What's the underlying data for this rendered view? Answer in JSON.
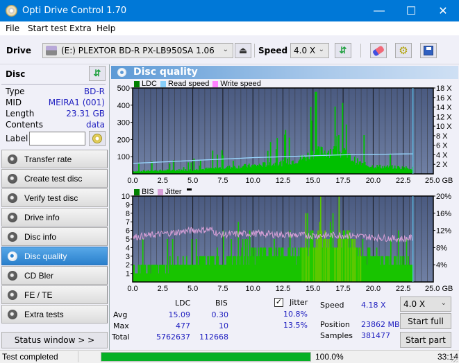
{
  "window": {
    "title": "Opti Drive Control 1.70",
    "controls": {
      "minimize": "—",
      "maximize": "☐",
      "close": "✕"
    }
  },
  "menu": {
    "items": [
      "File",
      "Start test",
      "Extra",
      "Help"
    ]
  },
  "toolbar": {
    "drive_label": "Drive",
    "drive_value": "(E:)  PLEXTOR BD-R  PX-LB950SA 1.06",
    "speed_label": "Speed",
    "speed_value": "4.0 X",
    "icons": [
      "drive-icon",
      "eject-icon",
      "refresh-icon",
      "eraser-icon",
      "settings-icon",
      "save-icon"
    ]
  },
  "disc": {
    "header": "Disc",
    "fields": [
      {
        "label": "Type",
        "value": "BD-R"
      },
      {
        "label": "MID",
        "value": "MEIRA1 (001)"
      },
      {
        "label": "Length",
        "value": "23.31 GB"
      },
      {
        "label": "Contents",
        "value": "data"
      }
    ],
    "label_field": {
      "label": "Label",
      "value": ""
    }
  },
  "nav": {
    "items": [
      {
        "label": "Transfer rate",
        "active": false
      },
      {
        "label": "Create test disc",
        "active": false
      },
      {
        "label": "Verify test disc",
        "active": false
      },
      {
        "label": "Drive info",
        "active": false
      },
      {
        "label": "Disc info",
        "active": false
      },
      {
        "label": "Disc quality",
        "active": true
      },
      {
        "label": "CD Bler",
        "active": false
      },
      {
        "label": "FE / TE",
        "active": false
      },
      {
        "label": "Extra tests",
        "active": false
      }
    ],
    "status_window": "Status window > >"
  },
  "panel": {
    "title": "Disc quality"
  },
  "chart_data": [
    {
      "type": "bar",
      "title": "LDC chart",
      "legend": [
        "LDC",
        "Read speed",
        "Write speed"
      ],
      "legend_colors": [
        "#008000",
        "#87cefa",
        "#ff80ff"
      ],
      "x_ticks": [
        "0.0",
        "2.5",
        "5.0",
        "7.5",
        "10.0",
        "12.5",
        "15.0",
        "17.5",
        "20.0",
        "22.5",
        "25.0 GB"
      ],
      "xlim": [
        0,
        25
      ],
      "y_ticks_left": [
        "500",
        "400",
        "300",
        "200",
        "100"
      ],
      "ylim_left": [
        0,
        500
      ],
      "y_ticks_right": [
        "18 X",
        "16 X",
        "14 X",
        "12 X",
        "10 X",
        "8 X",
        "6 X",
        "4 X",
        "2 X"
      ],
      "ylim_right": [
        0,
        18
      ],
      "end_marker_gb": 23.31,
      "ldc_base_profile": [
        [
          0,
          20
        ],
        [
          2.5,
          25
        ],
        [
          5,
          30
        ],
        [
          7.5,
          45
        ],
        [
          10,
          60
        ],
        [
          12.5,
          80
        ],
        [
          14,
          110
        ],
        [
          15,
          150
        ],
        [
          16.5,
          170
        ],
        [
          17.5,
          150
        ],
        [
          18,
          120
        ],
        [
          19,
          70
        ],
        [
          20,
          55
        ],
        [
          22.5,
          45
        ],
        [
          23.31,
          40
        ]
      ],
      "ldc_spike_max": 477,
      "read_speed_profile": [
        [
          0,
          2.2
        ],
        [
          2.5,
          2.5
        ],
        [
          5,
          2.8
        ],
        [
          7.5,
          3.1
        ],
        [
          10,
          3.4
        ],
        [
          12.5,
          3.6
        ],
        [
          15,
          3.8
        ],
        [
          17.5,
          4.0
        ],
        [
          20,
          4.1
        ],
        [
          23.31,
          4.2
        ]
      ]
    },
    {
      "type": "bar",
      "title": "BIS chart",
      "legend": [
        "BIS",
        "Jitter"
      ],
      "legend_colors": [
        "#008000",
        "#d8a0d8"
      ],
      "x_ticks": [
        "0.0",
        "2.5",
        "5.0",
        "7.5",
        "10.0",
        "12.5",
        "15.0",
        "17.5",
        "20.0",
        "22.5",
        "25.0 GB"
      ],
      "xlim": [
        0,
        25
      ],
      "y_ticks_left": [
        "10",
        "9",
        "8",
        "7",
        "6",
        "5",
        "4",
        "3",
        "2",
        "1"
      ],
      "ylim_left": [
        0,
        10
      ],
      "y_ticks_right": [
        "20%",
        "16%",
        "12%",
        "8%",
        "4%"
      ],
      "ylim_right": [
        0,
        20
      ],
      "end_marker_gb": 23.31,
      "bis_base_profile": [
        [
          0,
          2
        ],
        [
          7,
          3
        ],
        [
          11,
          4
        ],
        [
          14,
          4
        ],
        [
          15,
          6
        ],
        [
          16,
          7
        ],
        [
          18,
          6
        ],
        [
          19,
          4
        ],
        [
          21,
          3
        ],
        [
          23.31,
          3
        ]
      ],
      "bis_max": 10,
      "jitter_profile_pct": [
        [
          0,
          10.4
        ],
        [
          2.5,
          11.2
        ],
        [
          5,
          12
        ],
        [
          6.5,
          12.2
        ],
        [
          7.2,
          11
        ],
        [
          10,
          11.3
        ],
        [
          12.5,
          11
        ],
        [
          15,
          10.8
        ],
        [
          17.5,
          10.9
        ],
        [
          20,
          10.4
        ],
        [
          22.5,
          10.0
        ],
        [
          23.31,
          10.3
        ]
      ]
    }
  ],
  "stats": {
    "col_ldc": "LDC",
    "col_bis": "BIS",
    "rows": [
      {
        "label": "Avg",
        "ldc": "15.09",
        "bis": "0.30",
        "jitter": "10.8%"
      },
      {
        "label": "Max",
        "ldc": "477",
        "bis": "10",
        "jitter": "13.5%"
      },
      {
        "label": "Total",
        "ldc": "5762637",
        "bis": "112668"
      }
    ],
    "jitter_label": "Jitter",
    "jitter_checked": true,
    "speed_label": "Speed",
    "speed_value": "4.18 X",
    "position_label": "Position",
    "position_value": "23862 MB",
    "samples_label": "Samples",
    "samples_value": "381477",
    "speed_select": "4.0 X",
    "start_full": "Start full",
    "start_part": "Start part"
  },
  "status": {
    "text": "Test completed",
    "progress_pct": 100.0,
    "progress_text": "100.0%",
    "time": "33:14"
  }
}
